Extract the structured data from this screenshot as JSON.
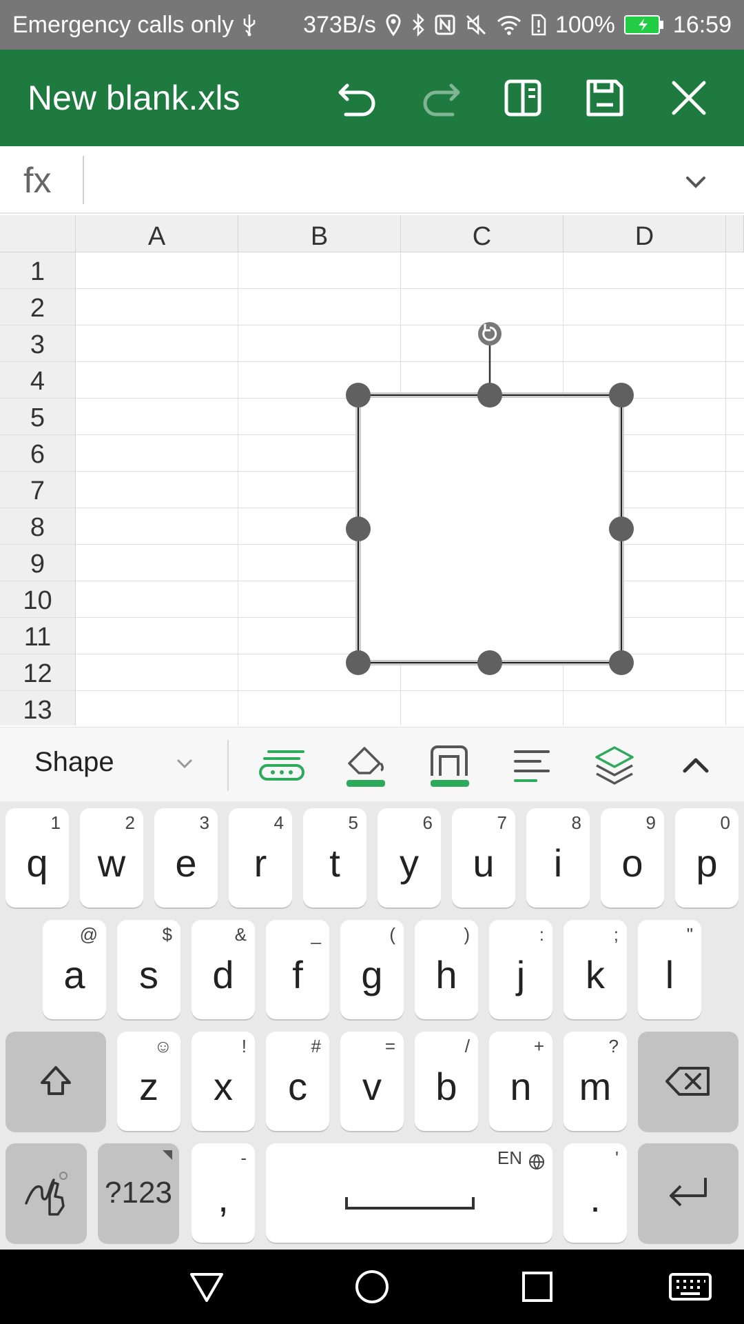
{
  "status_bar": {
    "carrier": "Emergency calls only",
    "speed": "373B/s",
    "battery": "100%",
    "time": "16:59"
  },
  "header": {
    "title": "New blank.xls"
  },
  "formula_bar": {
    "label": "fx"
  },
  "grid": {
    "columns": [
      "A",
      "B",
      "C",
      "D"
    ],
    "rows": [
      "1",
      "2",
      "3",
      "4",
      "5",
      "6",
      "7",
      "8",
      "9",
      "10",
      "11",
      "12",
      "13"
    ]
  },
  "toolbar": {
    "mode": "Shape"
  },
  "keyboard": {
    "row1": [
      {
        "key": "q",
        "sub": "1"
      },
      {
        "key": "w",
        "sub": "2"
      },
      {
        "key": "e",
        "sub": "3"
      },
      {
        "key": "r",
        "sub": "4"
      },
      {
        "key": "t",
        "sub": "5"
      },
      {
        "key": "y",
        "sub": "6"
      },
      {
        "key": "u",
        "sub": "7"
      },
      {
        "key": "i",
        "sub": "8"
      },
      {
        "key": "o",
        "sub": "9"
      },
      {
        "key": "p",
        "sub": "0"
      }
    ],
    "row2": [
      {
        "key": "a",
        "sub": "@"
      },
      {
        "key": "s",
        "sub": "$"
      },
      {
        "key": "d",
        "sub": "&"
      },
      {
        "key": "f",
        "sub": "_"
      },
      {
        "key": "g",
        "sub": "("
      },
      {
        "key": "h",
        "sub": ")"
      },
      {
        "key": "j",
        "sub": ":"
      },
      {
        "key": "k",
        "sub": ";"
      },
      {
        "key": "l",
        "sub": "\""
      }
    ],
    "row3": [
      {
        "key": "z",
        "sub": "☺"
      },
      {
        "key": "x",
        "sub": "!"
      },
      {
        "key": "c",
        "sub": "#"
      },
      {
        "key": "v",
        "sub": "="
      },
      {
        "key": "b",
        "sub": "/"
      },
      {
        "key": "n",
        "sub": "+"
      },
      {
        "key": "m",
        "sub": "?"
      }
    ],
    "symbols_label": "?123",
    "comma": {
      "key": ",",
      "sub": "-"
    },
    "period": {
      "key": ".",
      "sub": "'"
    },
    "space_lang": "EN"
  }
}
